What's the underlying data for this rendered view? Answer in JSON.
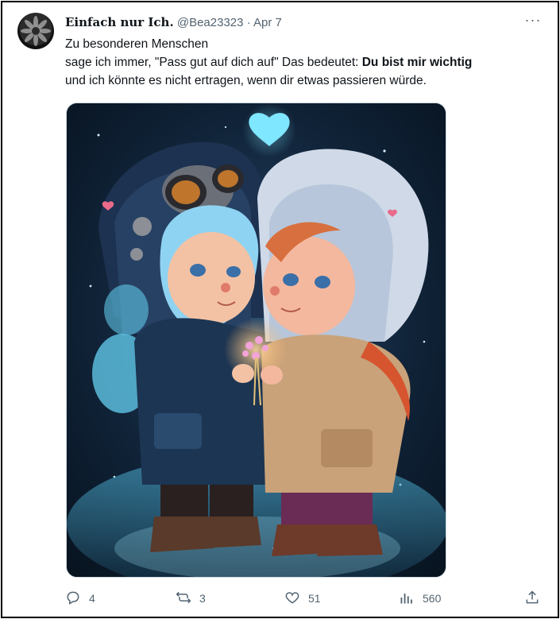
{
  "tweet": {
    "display_name": "Einfach nur Ich.",
    "handle": "@Bea23323",
    "separator": "·",
    "date": "Apr 7",
    "more": "···",
    "line1": "Zu besonderen Menschen",
    "line2_a": "sage ich immer, \"Pass gut auf dich auf\" Das bedeutet: ",
    "line2_bold": "Du bist mir wichtig",
    "line3": "und ich könnte es nicht ertragen, wenn dir etwas passieren würde."
  },
  "actions": {
    "replies": "4",
    "retweets": "3",
    "likes": "51",
    "views": "560"
  },
  "icons": {
    "reply": "speech-bubble-icon",
    "retweet": "retweet-icon",
    "like": "heart-icon",
    "views": "bar-chart-icon",
    "share": "share-icon"
  },
  "colors": {
    "text": "#0f1419",
    "muted": "#536471"
  }
}
